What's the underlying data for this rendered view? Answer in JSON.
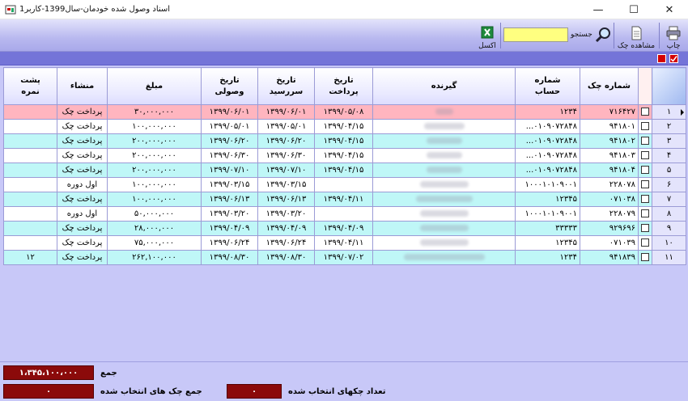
{
  "window": {
    "title": "اسناد وصول شده خودمان-سال1399-کاربر1",
    "minimize": "—",
    "maximize": "☐",
    "close": "✕"
  },
  "toolbar": {
    "print_label": "چاپ",
    "view_cheque_label": "مشاهده چک",
    "search_label": "جستجو",
    "search_value": "",
    "excel_label": "اکسل"
  },
  "grid": {
    "headers": {
      "cheque_no": "شماره چک",
      "account_no_1": "شماره",
      "account_no_2": "حساب",
      "receiver": "گیرنده",
      "pay_date_1": "تاریخ",
      "pay_date_2": "پرداخت",
      "due_date_1": "تاریخ",
      "due_date_2": "سررسید",
      "recv_date_1": "تاریخ",
      "recv_date_2": "وصولی",
      "amount": "مبلغ",
      "origin": "منشاء",
      "back_1": "پشت",
      "back_2": "نمره"
    },
    "rows": [
      {
        "n": "۱",
        "cheque": "۷۱۶۴۲۷",
        "account": "۱۲۳۴",
        "pay": "۱۳۹۹/۰۵/۰۸",
        "due": "۱۳۹۹/۰۶/۰۱",
        "recv": "۱۳۹۹/۰۶/۰۱",
        "amount": "۳۰,۰۰۰,۰۰۰",
        "origin": "پرداخت چک",
        "back": ""
      },
      {
        "n": "۲",
        "cheque": "۹۴۱۸۰۱",
        "account": "...۰۱۰۹۰۷۲۸۴۸",
        "pay": "۱۳۹۹/۰۴/۱۵",
        "due": "۱۳۹۹/۰۵/۰۱",
        "recv": "۱۳۹۹/۰۵/۰۱",
        "amount": "۱۰۰,۰۰۰,۰۰۰",
        "origin": "پرداخت چک",
        "back": ""
      },
      {
        "n": "۳",
        "cheque": "۹۴۱۸۰۲",
        "account": "...۰۱۰۹۰۷۲۸۴۸",
        "pay": "۱۳۹۹/۰۴/۱۵",
        "due": "۱۳۹۹/۰۶/۲۰",
        "recv": "۱۳۹۹/۰۶/۲۰",
        "amount": "۲۰۰,۰۰۰,۰۰۰",
        "origin": "پرداخت چک",
        "back": ""
      },
      {
        "n": "۴",
        "cheque": "۹۴۱۸۰۳",
        "account": "...۰۱۰۹۰۷۲۸۴۸",
        "pay": "۱۳۹۹/۰۴/۱۵",
        "due": "۱۳۹۹/۰۶/۳۰",
        "recv": "۱۳۹۹/۰۶/۳۰",
        "amount": "۲۰۰,۰۰۰,۰۰۰",
        "origin": "پرداخت چک",
        "back": ""
      },
      {
        "n": "۵",
        "cheque": "۹۴۱۸۰۴",
        "account": "...۰۱۰۹۰۷۲۸۴۸",
        "pay": "۱۳۹۹/۰۴/۱۵",
        "due": "۱۳۹۹/۰۷/۱۰",
        "recv": "۱۳۹۹/۰۷/۱۰",
        "amount": "۲۰۰,۰۰۰,۰۰۰",
        "origin": "پرداخت چک",
        "back": ""
      },
      {
        "n": "۶",
        "cheque": "۲۲۸۰۷۸",
        "account": "۱۰۰۰۱۰۱۰۹۰۰۱",
        "pay": "",
        "due": "۱۳۹۹/۰۳/۱۵",
        "recv": "۱۳۹۹/۰۳/۱۵",
        "amount": "۱۰۰,۰۰۰,۰۰۰",
        "origin": "اول دوره",
        "back": ""
      },
      {
        "n": "۷",
        "cheque": "۰۷۱۰۳۸",
        "account": "۱۲۳۴۵",
        "pay": "۱۳۹۹/۰۴/۱۱",
        "due": "۱۳۹۹/۰۶/۱۳",
        "recv": "۱۳۹۹/۰۶/۱۳",
        "amount": "۱۰۰,۰۰۰,۰۰۰",
        "origin": "پرداخت چک",
        "back": ""
      },
      {
        "n": "۸",
        "cheque": "۲۲۸۰۷۹",
        "account": "۱۰۰۰۱۰۱۰۹۰۰۱",
        "pay": "",
        "due": "۱۳۹۹/۰۳/۲۰",
        "recv": "۱۳۹۹/۰۳/۲۰",
        "amount": "۵۰,۰۰۰,۰۰۰",
        "origin": "اول دوره",
        "back": ""
      },
      {
        "n": "۹",
        "cheque": "۹۲۹۶۹۶",
        "account": "۳۳۳۳۳",
        "pay": "۱۳۹۹/۰۴/۰۹",
        "due": "۱۳۹۹/۰۴/۰۹",
        "recv": "۱۳۹۹/۰۴/۰۹",
        "amount": "۲۸,۰۰۰,۰۰۰",
        "origin": "پرداخت چک",
        "back": ""
      },
      {
        "n": "۱۰",
        "cheque": "۰۷۱۰۳۹",
        "account": "۱۲۳۴۵",
        "pay": "۱۳۹۹/۰۴/۱۱",
        "due": "۱۳۹۹/۰۶/۲۴",
        "recv": "۱۳۹۹/۰۶/۲۴",
        "amount": "۷۵,۰۰۰,۰۰۰",
        "origin": "پرداخت چک",
        "back": ""
      },
      {
        "n": "۱۱",
        "cheque": "۹۴۱۸۳۹",
        "account": "۱۲۳۴",
        "pay": "۱۳۹۹/۰۷/۰۲",
        "due": "۱۳۹۹/۰۸/۳۰",
        "recv": "۱۳۹۹/۰۸/۳۰",
        "amount": "۲۶۲,۱۰۰,۰۰۰",
        "origin": "پرداخت چک",
        "back": "۱۲"
      }
    ]
  },
  "footer": {
    "total_label": "جمع",
    "total_value": "۱،۳۴۵،۱۰۰،۰۰۰",
    "selected_sum_label": "جمع چک های انتخاب شده",
    "selected_sum_value": "۰",
    "selected_count_label": "تعداد چکهای انتخاب شده",
    "selected_count_value": "۰"
  },
  "colors": {
    "selected_row": "#ffb5bf",
    "alt_row": "#bff7f7",
    "footer_box": "#8b0a0a",
    "search_bg": "#ffff80"
  }
}
